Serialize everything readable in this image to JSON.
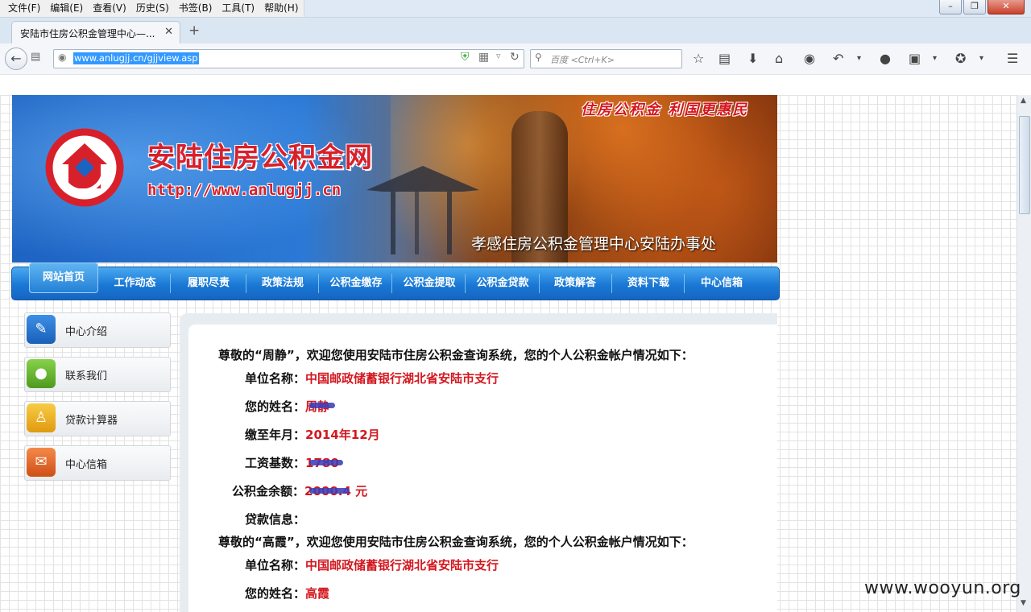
{
  "browser": {
    "menu": [
      "文件(F)",
      "编辑(E)",
      "查看(V)",
      "历史(S)",
      "书签(B)",
      "工具(T)",
      "帮助(H)"
    ],
    "tab_title": "安陆市住房公积金管理中心—...",
    "url": "www.anlugjj.cn/gjjview.asp",
    "search_placeholder": "百度 <Ctrl+K>"
  },
  "banner": {
    "title": "安陆住房公积金网",
    "url": "http://www.anlugjj.cn",
    "slogan": "住房公积金 利国更惠民",
    "subtitle": "孝感住房公积金管理中心安陆办事处"
  },
  "nav": {
    "home": "网站首页",
    "items": [
      "工作动态",
      "履职尽责",
      "政策法规",
      "公积金缴存",
      "公积金提取",
      "公积金贷款",
      "政策解答",
      "资料下载",
      "中心信箱"
    ]
  },
  "sidebar": {
    "items": [
      {
        "label": "中心介绍",
        "icon": "pen-icon",
        "color": "#1a6fd0"
      },
      {
        "label": "联系我们",
        "icon": "lightbulb-icon",
        "color": "#6ab82a"
      },
      {
        "label": "贷款计算器",
        "icon": "walker-icon",
        "color": "#f0b41a"
      },
      {
        "label": "中心信箱",
        "icon": "mail-icon",
        "color": "#e06a25"
      }
    ]
  },
  "content": {
    "record1": {
      "greeting": "尊敬的“周静”，欢迎您使用安陆市住房公积金查询系统，您的个人公积金帐户情况如下：",
      "employer_label": "单位名称：",
      "employer": "中国邮政储蓄银行湖北省安陆市支行",
      "name_label": "您的姓名：",
      "name": "周静",
      "paid_label": "缴至年月：",
      "paid_to": "2014年12月",
      "salary_label": "工资基数：",
      "salary": "1780",
      "balance_label": "公积金余额：",
      "balance": "2000.4 元",
      "loan_label": "贷款信息："
    },
    "record2": {
      "greeting": "尊敬的“高霞”，欢迎您使用安陆市住房公积金查询系统，您的个人公积金帐户情况如下：",
      "employer_label": "单位名称：",
      "employer": "中国邮政储蓄银行湖北省安陆市支行",
      "name_label": "您的姓名：",
      "name": "高霞"
    }
  },
  "watermark": "www.wooyun.org"
}
